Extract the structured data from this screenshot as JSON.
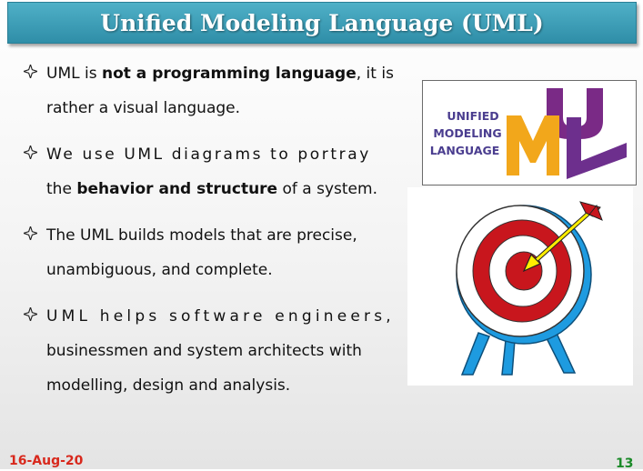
{
  "slide": {
    "title": "Unified Modeling Language (UML)",
    "bullets": [
      {
        "lines": [
          [
            {
              "text": "UML is "
            },
            {
              "text": "not a programming language",
              "bold": true
            },
            {
              "text": ", it is"
            }
          ],
          [
            {
              "text": "rather a visual language."
            }
          ]
        ]
      },
      {
        "lines": [
          [
            {
              "text": "We use UML diagrams to portray"
            }
          ],
          [
            {
              "text": "the "
            },
            {
              "text": "behavior and structure",
              "bold": true
            },
            {
              "text": " of a system."
            }
          ]
        ]
      },
      {
        "lines": [
          [
            {
              "text": "The UML builds models that are precise,"
            }
          ],
          [
            {
              "text": "unambiguous, and complete."
            }
          ]
        ]
      },
      {
        "lines": [
          [
            {
              "text": "UML helps software engineers,"
            }
          ],
          [
            {
              "text": "businessmen and system architects with"
            }
          ],
          [
            {
              "text": "modelling, design and analysis."
            }
          ]
        ]
      }
    ],
    "footer": {
      "date": "16-Aug-20",
      "page_number": "13"
    }
  },
  "uml_logo": {
    "words": [
      "UNIFIED",
      "MODELING",
      "LANGUAGE"
    ],
    "letters": [
      "U",
      "M",
      "L"
    ],
    "colors": {
      "text": "#4a3d8f",
      "U": "#7a2a86",
      "M": "#f2a71b",
      "L": "#6d2f8d"
    }
  },
  "target_icon": {
    "colors": {
      "ring_red": "#c8161d",
      "ring_white": "#ffffff",
      "legs": "#1e9be0",
      "arrow_shaft": "#ffee00",
      "arrow_head": "#c8161d"
    }
  },
  "colors": {
    "title_bar": "#3a9ab4",
    "date": "#d8281c",
    "page_number": "#1a8a28"
  }
}
